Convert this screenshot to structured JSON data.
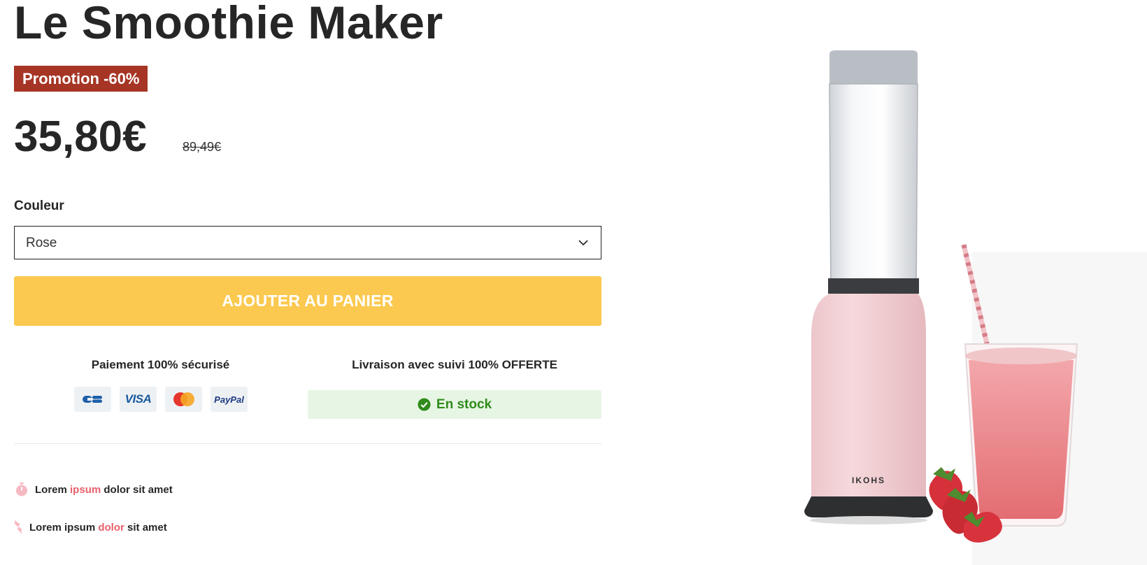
{
  "product": {
    "title": "Le Smoothie Maker",
    "promo_badge": "Promotion -60%",
    "price": "35,80€",
    "old_price": "89,49€"
  },
  "color_select": {
    "label": "Couleur",
    "selected": "Rose"
  },
  "cart": {
    "button_label": "AJOUTER AU PANIER"
  },
  "payment": {
    "title": "Paiement 100% sécurisé",
    "methods": [
      "cb-icon",
      "visa-icon",
      "mastercard-icon",
      "paypal-icon"
    ],
    "visa_text": "VISA",
    "paypal_text": "PayPal"
  },
  "shipping": {
    "title": "Livraison avec suivi 100% OFFERTE",
    "stock_status": "En stock"
  },
  "features": [
    {
      "icon": "stopwatch-icon",
      "before": "Lorem",
      "highlight": "ipsum",
      "after": "dolor sit amet"
    },
    {
      "icon": "lightning-icon",
      "before": "Lorem ipsum",
      "highlight": "dolor",
      "after": "sit amet"
    }
  ],
  "image": {
    "brand_text": "IKOHS"
  },
  "colors": {
    "promo_bg": "#a63525",
    "cart_button": "#fbc94f",
    "stock_bg": "#e7f6e4",
    "stock_text": "#2f8b1c",
    "highlight": "#e8606a",
    "blender_pink": "#f2cfd2"
  }
}
